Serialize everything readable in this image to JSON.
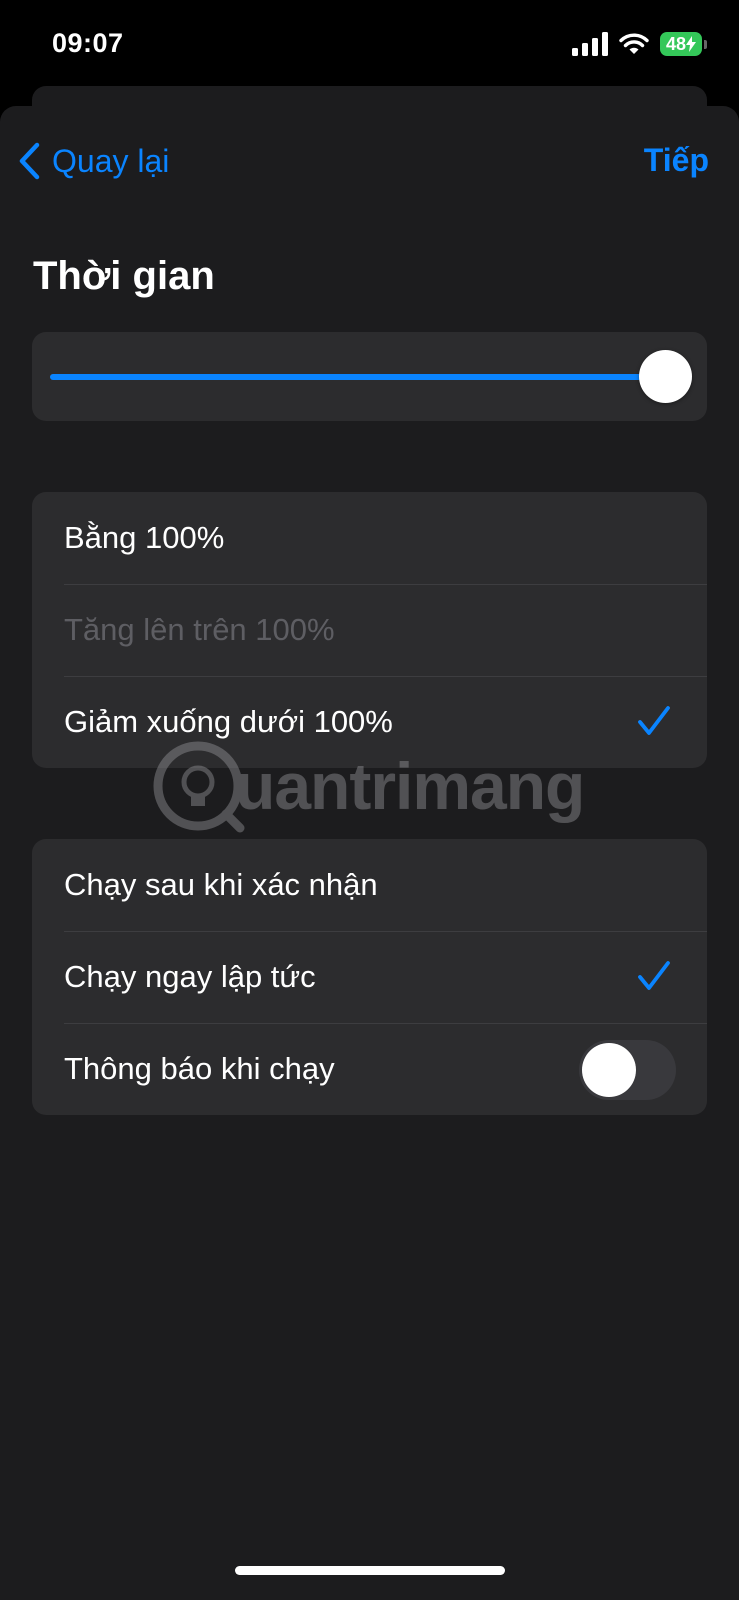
{
  "status_bar": {
    "time": "09:07",
    "battery": "48"
  },
  "nav": {
    "back_label": "Quay lại",
    "next_label": "Tiếp"
  },
  "section_title": "Thời gian",
  "slider": {
    "value_fraction": 1.0,
    "accent": "#0a84ff"
  },
  "comparison_options": [
    {
      "label": "Bằng 100%",
      "checked": false,
      "enabled": true
    },
    {
      "label": "Tăng lên trên 100%",
      "checked": false,
      "enabled": false
    },
    {
      "label": "Giảm xuống dưới 100%",
      "checked": true,
      "enabled": true
    }
  ],
  "run_options": [
    {
      "label": "Chạy sau khi xác nhận",
      "checked": false
    },
    {
      "label": "Chạy ngay lập tức",
      "checked": true
    }
  ],
  "notify_row": {
    "label": "Thông báo khi chạy",
    "toggle_on": false
  },
  "watermark": {
    "text": "uantrimang"
  },
  "colors": {
    "accent": "#0a84ff",
    "background": "#1c1c1e",
    "card": "#2c2c2e",
    "battery": "#34c759"
  }
}
